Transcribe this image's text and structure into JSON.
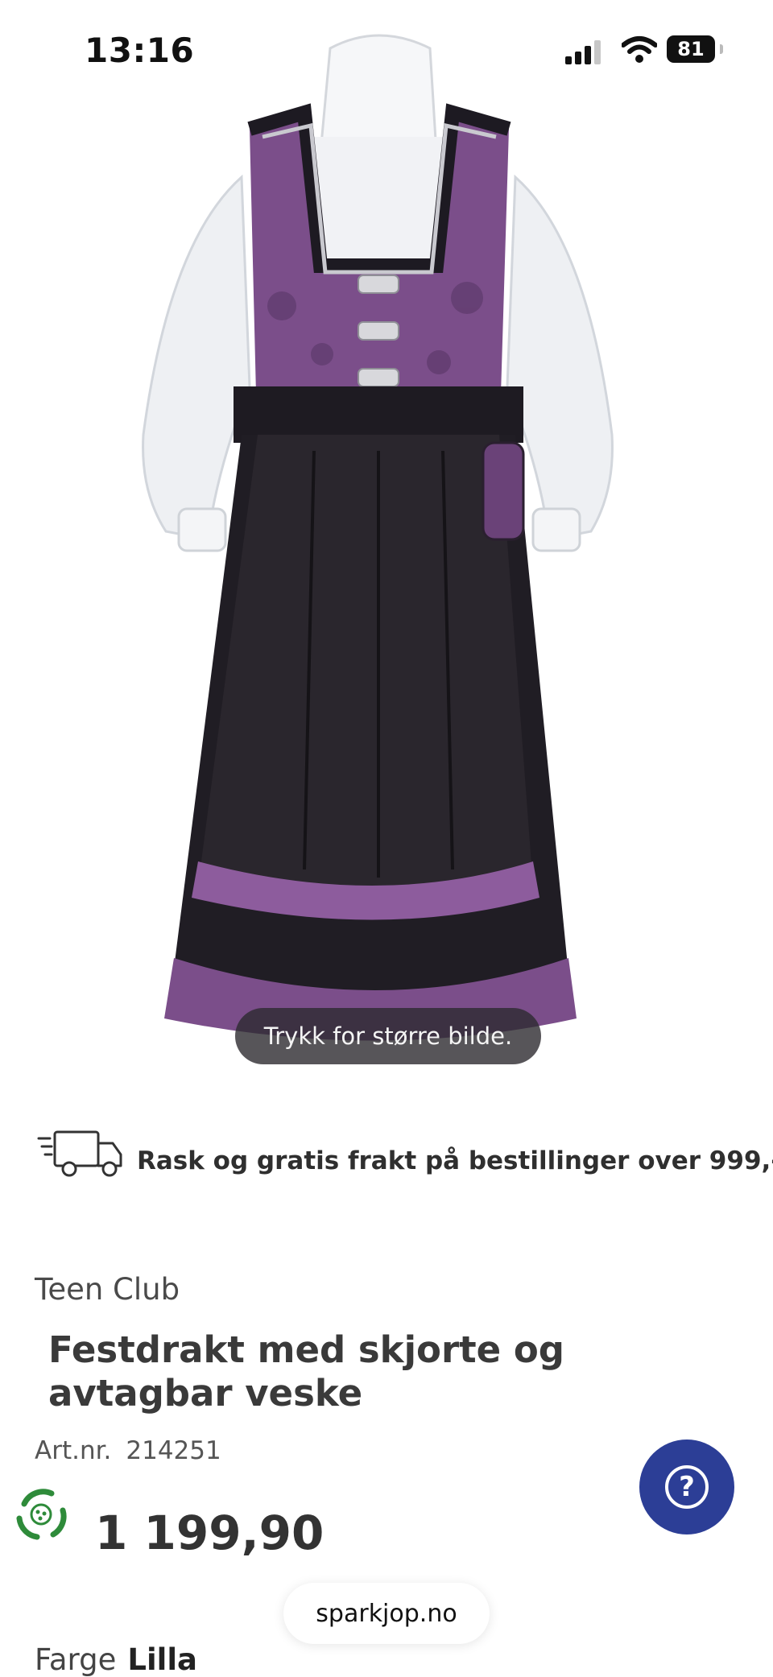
{
  "status_bar": {
    "time": "13:16",
    "battery": "81"
  },
  "product": {
    "zoom_hint": "Trykk for større bilde.",
    "shipping": "Rask og gratis frakt på bestillinger over 999,-",
    "brand": "Teen Club",
    "title": "Festdrakt med skjorte og avtagbar veske",
    "artnr_label": "Art.nr.",
    "artnr_value": "214251",
    "price": "1 199,90",
    "color_label": "Farge",
    "color_value": "Lilla"
  },
  "browser": {
    "url": "sparkjop.no"
  },
  "colors": {
    "accent_blue": "#2c3e96",
    "eco_green": "#2e8b3a",
    "dress_purple": "#7b4e8a"
  },
  "icons": [
    "signal-icon",
    "wifi-icon",
    "truck-icon",
    "eco-icon",
    "help-icon"
  ]
}
